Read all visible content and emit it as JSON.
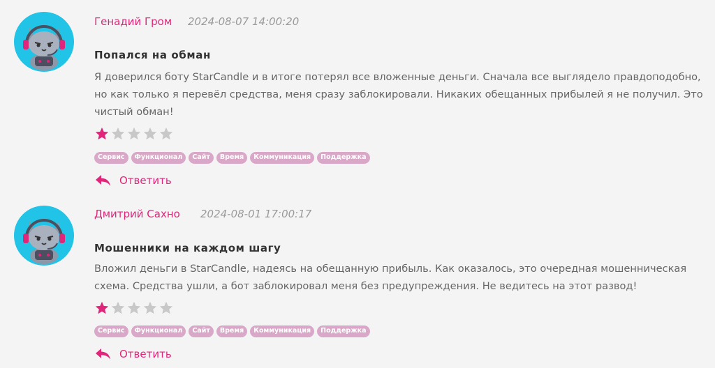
{
  "tag_labels": [
    "Сервис",
    "Функционал",
    "Сайт",
    "Время",
    "Коммуникация",
    "Поддержка"
  ],
  "reviews": [
    {
      "author": "Генадий Гром",
      "date": "2024-08-07 14:00:20",
      "title": "Попался на обман",
      "text": "Я доверился боту StarCandle и в итоге потерял все вложенные деньги. Сначала все выглядело правдоподобно, но как только я перевёл средства, меня сразу заблокировали. Никаких обещанных прибылей я не получил. Это чистый обман!",
      "rating": 1,
      "rating_max": 5,
      "reply_label": "Ответить"
    },
    {
      "author": "Дмитрий Сахно",
      "date": "2024-08-01 17:00:17",
      "title": "Мошенники на каждом шагу",
      "text": "Вложил деньги в StarCandle, надеясь на обещанную прибыль. Как оказалось, это очередная мошенническая схема. Средства ушли, а бот заблокировал меня без предупреждения. Не ведитесь на этот развод!",
      "rating": 1,
      "rating_max": 5,
      "reply_label": "Ответить"
    }
  ],
  "colors": {
    "accent": "#e0267a",
    "star_filled": "#e0267a",
    "star_empty": "#c8c8c8",
    "tag_bg": "#d9a8c8",
    "avatar_bg": "#21c3e6"
  },
  "icons": {
    "avatar": "cat-gamer-avatar-icon",
    "star": "star-icon",
    "reply": "reply-arrow-icon"
  }
}
